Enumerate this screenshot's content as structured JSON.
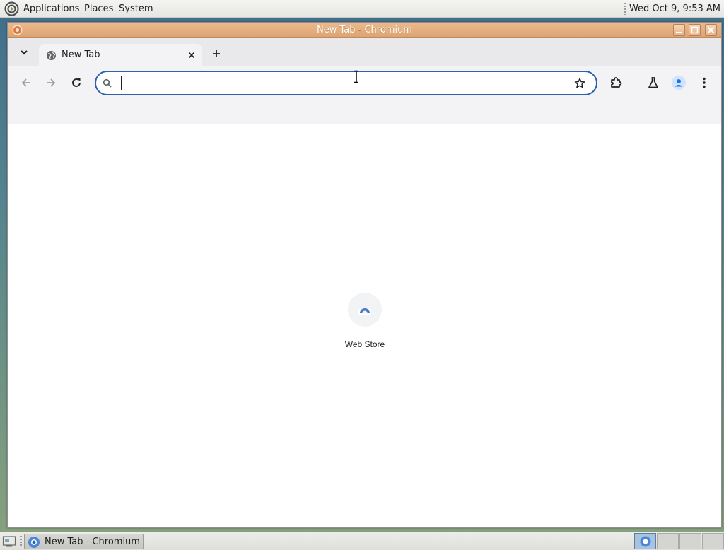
{
  "top_panel": {
    "menus": [
      "Applications",
      "Places",
      "System"
    ],
    "clock": "Wed Oct  9,  9:53 AM"
  },
  "window": {
    "title": "New Tab - Chromium",
    "tab": {
      "title": "New Tab"
    },
    "omnibox": {
      "value": "",
      "placeholder": ""
    },
    "shortcut": {
      "label": "Web Store"
    }
  },
  "taskbar": {
    "items": [
      {
        "label": "New Tab - Chromium"
      }
    ]
  },
  "colors": {
    "titlebar": "#dba372",
    "omnibox_focus": "#2f5fb2",
    "profile": "#1a73e8"
  }
}
